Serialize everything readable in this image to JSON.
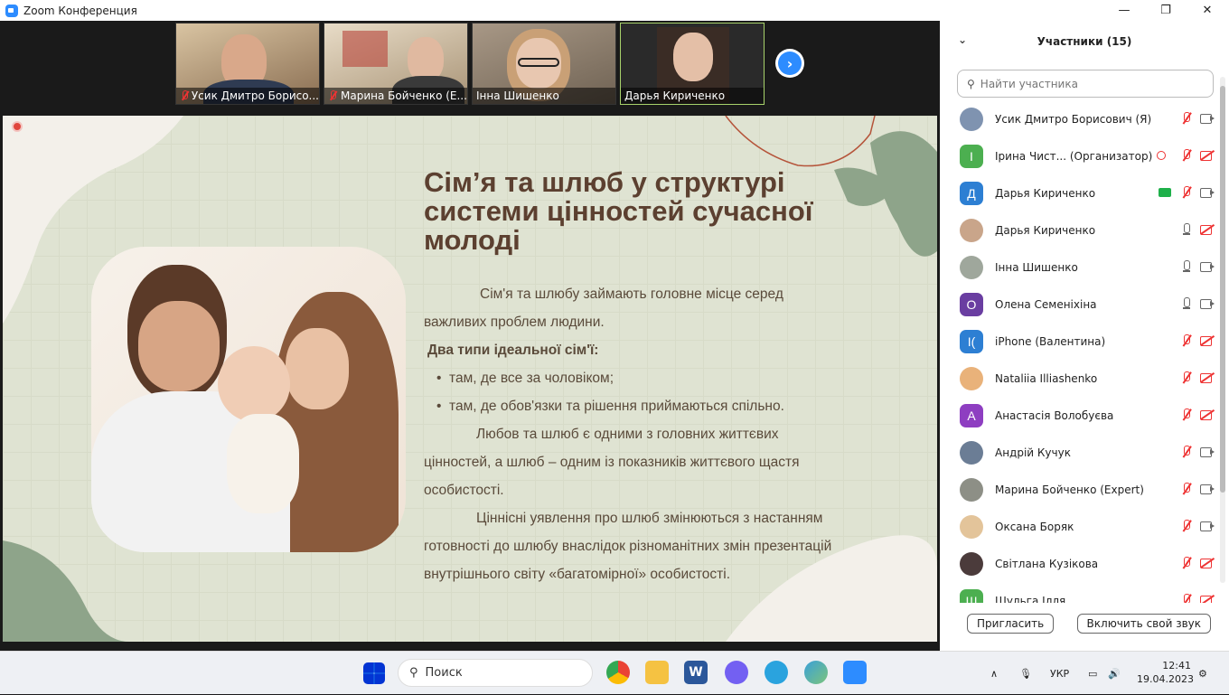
{
  "window": {
    "title": "Zoom Конференция",
    "controls": [
      "—",
      "❐",
      "✕"
    ]
  },
  "recording": {
    "label": ""
  },
  "thumbnails": [
    {
      "name": "Усик Дмитро Борисо...",
      "muted": true,
      "bg": "#b49a78"
    },
    {
      "name": "Марина Бойченко (E...",
      "muted": true,
      "bg": "#c9b79a"
    },
    {
      "name": "Інна Шишенко",
      "muted": false,
      "bg": "#9a8a78"
    },
    {
      "name": "Дарья Кириченко",
      "muted": false,
      "bg": "#3a2c25",
      "active": true
    }
  ],
  "slide": {
    "title": "Сім’я та шлюб у структурі системи цінностей сучасної молоді",
    "p1": "Сім'я та шлюбу займають головне місце серед",
    "p1b": "важливих проблем людини.",
    "types_heading": "Два типи ідеальної сім'ї:",
    "bullet1": "там, де все за чоловіком;",
    "bullet2": "там, де обов'язки та рішення приймаються спільно.",
    "p2": "Любов та шлюб є одними з головних життєвих",
    "p2b": "цінностей, а шлюб – одним із показників життєвого щастя",
    "p2c": "особистості.",
    "p3": "Ціннісні уявлення про шлюб змінюються з настанням",
    "p3b": "готовності до шлюбу внаслідок різноманітних змін презентацій",
    "p3c": "внутрішнього світу «багатомірної» особистості."
  },
  "panel": {
    "title": "Участники (15)",
    "search_placeholder": "Найти участника",
    "invite_label": "Пригласить",
    "unmute_label": "Включить свой звук",
    "participants": [
      {
        "name": "Усик Дмитро Борисович (Я)",
        "avatar": "",
        "color": "#7f93b0",
        "mic": "off",
        "cam": "on"
      },
      {
        "name": "Ірина Чист... (Организатор)",
        "avatar": "I",
        "color": "#4caf50",
        "mic": "off",
        "cam": "off",
        "rec": true
      },
      {
        "name": "Дарья Кириченко",
        "avatar": "Д",
        "color": "#2d7fd3",
        "mic": "off",
        "cam": "on",
        "share": true
      },
      {
        "name": "Дарья Кириченко",
        "avatar": "",
        "color": "#c9a58a",
        "mic": "on",
        "cam": "off"
      },
      {
        "name": "Інна Шишенко",
        "avatar": "",
        "color": "#9fa79c",
        "mic": "on",
        "cam": "on"
      },
      {
        "name": "Олена Семеніхіна",
        "avatar": "О",
        "color": "#6a3ea1",
        "mic": "on",
        "cam": "on"
      },
      {
        "name": "iPhone (Валентина)",
        "avatar": "I(",
        "color": "#2d7fd3",
        "mic": "off",
        "cam": "off"
      },
      {
        "name": "Nataliia Illiashenko",
        "avatar": "",
        "color": "#e9b27a",
        "mic": "off",
        "cam": "off"
      },
      {
        "name": "Анастасія Волобуєва",
        "avatar": "А",
        "color": "#8e3ec1",
        "mic": "off",
        "cam": "off"
      },
      {
        "name": "Андрій Кучук",
        "avatar": "",
        "color": "#6b7d95",
        "mic": "off",
        "cam": "on"
      },
      {
        "name": "Марина Бойченко (Expert)",
        "avatar": "",
        "color": "#8d8f86",
        "mic": "off",
        "cam": "on"
      },
      {
        "name": "Оксана Боряк",
        "avatar": "",
        "color": "#e3c49a",
        "mic": "off",
        "cam": "on"
      },
      {
        "name": "Світлана Кузікова",
        "avatar": "",
        "color": "#4b3b3b",
        "mic": "off",
        "cam": "off"
      },
      {
        "name": "Шульга Ілля",
        "avatar": "Ш",
        "color": "#4caf50",
        "mic": "off",
        "cam": "off"
      }
    ]
  },
  "taskbar": {
    "search_label": "Поиск",
    "lang": "УКР",
    "time": "12:41",
    "date": "19.04.2023"
  }
}
